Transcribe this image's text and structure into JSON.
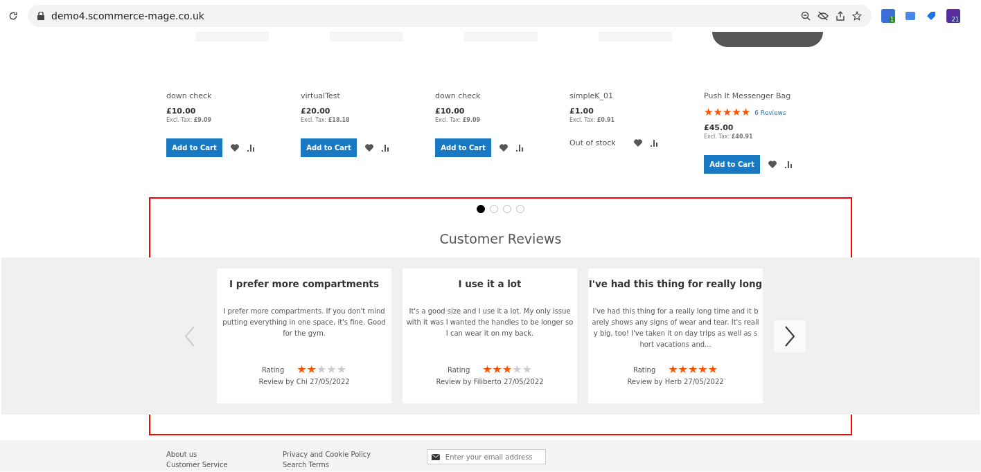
{
  "browser": {
    "url": "demo4.scommerce-mage.co.uk",
    "extension_badges": [
      "1",
      "21"
    ]
  },
  "products": [
    {
      "name": "down check",
      "price": "£10.00",
      "tax_label": "Excl. Tax:",
      "tax": "£9.09",
      "kind": "cart",
      "action": "Add to Cart"
    },
    {
      "name": "virtualTest",
      "price": "£20.00",
      "tax_label": "Excl. Tax:",
      "tax": "£18.18",
      "kind": "cart",
      "action": "Add to Cart"
    },
    {
      "name": "down check",
      "price": "£10.00",
      "tax_label": "Excl. Tax:",
      "tax": "£9.09",
      "kind": "cart",
      "action": "Add to Cart"
    },
    {
      "name": "simpleK_01",
      "price": "£1.00",
      "tax_label": "Excl. Tax:",
      "tax": "£0.91",
      "kind": "stock",
      "action": "Out of stock"
    },
    {
      "name": "Push It Messenger Bag",
      "stars": 5,
      "reviews_link": "6  Reviews",
      "price": "£45.00",
      "tax_label": "Excl. Tax:",
      "tax": "£40.91",
      "kind": "cart",
      "action": "Add to Cart"
    }
  ],
  "slider_dots": [
    {
      "selected": true
    },
    {
      "selected": false
    },
    {
      "selected": false
    },
    {
      "selected": false
    }
  ],
  "reviews_title": "Customer Reviews",
  "reviews": [
    {
      "title": "I prefer more compartments",
      "text": "I prefer more compartments. If you don't mind putting everything in one space, it's fine. Good for the gym.",
      "rating_label": "Rating",
      "stars": 2,
      "byline": "Review by Chi  27/05/2022"
    },
    {
      "title": "I use it a lot",
      "text": "It's a good size and I use it a lot. My only issue with it was I wanted the handles to be longer so I can wear it on my back.",
      "rating_label": "Rating",
      "stars": 3,
      "byline": "Review by Filiberto  27/05/2022"
    },
    {
      "title": "I've had this thing for really long",
      "text": "I've had this thing for a really long time and it barely shows any signs of wear and tear. It's really big, too! I've taken it on day trips as well as short vacations and...",
      "rating_label": "Rating",
      "stars": 5,
      "byline": "Review by Herb  27/05/2022"
    }
  ],
  "footer": {
    "column_1": [
      "About us",
      "Customer Service"
    ],
    "column_2": [
      "Privacy and Cookie Policy",
      "Search Terms"
    ],
    "newsletter": {
      "placeholder": "Enter your email address"
    }
  }
}
